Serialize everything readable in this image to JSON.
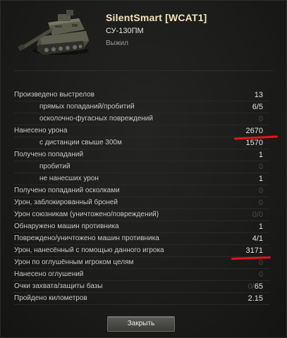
{
  "header": {
    "player_name": "SilentSmart [WCAT1]",
    "vehicle_name": "СУ-130ПМ",
    "status": "Выжил"
  },
  "stats": [
    {
      "label": "Произведено выстрелов",
      "value": "13",
      "indent": 0,
      "dim": false
    },
    {
      "label": "прямых попаданий/пробитий",
      "value": "6/5",
      "indent": 1,
      "dim": false
    },
    {
      "label": "осколочно-фугасных повреждений",
      "value": "0",
      "indent": 1,
      "dim": true
    },
    {
      "label": "Нанесено урона",
      "value": "2670",
      "indent": 0,
      "dim": false,
      "underlined": true
    },
    {
      "label": "с дистанции свыше 300м",
      "value": "1570",
      "indent": 1,
      "dim": false
    },
    {
      "label": "Получено попаданий",
      "value": "1",
      "indent": 0,
      "dim": false
    },
    {
      "label": "пробитий",
      "value": "0",
      "indent": 1,
      "dim": true
    },
    {
      "label": "не нанесших урон",
      "value": "1",
      "indent": 1,
      "dim": false
    },
    {
      "label": "Получено попаданий осколками",
      "value": "0",
      "indent": 0,
      "dim": true
    },
    {
      "label": "Урон, заблокированный броней",
      "value": "0",
      "indent": 0,
      "dim": true
    },
    {
      "label": "Урон союзникам (уничтожено/повреждений)",
      "value": "0/0",
      "indent": 0,
      "dim": true
    },
    {
      "label": "Обнаружено машин противника",
      "value": "1",
      "indent": 0,
      "dim": false
    },
    {
      "label": "Повреждено/уничтожено машин противника",
      "value": "4/1",
      "indent": 0,
      "dim": false
    },
    {
      "label": "Урон, нанесённый с помощью данного игрока",
      "value": "3171",
      "indent": 0,
      "dim": false,
      "underlined": true
    },
    {
      "label": "Урон по оглушённым игроком целям",
      "value": "0",
      "indent": 0,
      "dim": true
    },
    {
      "label": "Нанесено оглушений",
      "value": "0",
      "indent": 0,
      "dim": true
    },
    {
      "label": "Очки захвата/защиты базы",
      "value_dim_part": "0/",
      "value": "65",
      "indent": 0,
      "dim": false
    },
    {
      "label": "Пройдено километров",
      "value": "2.15",
      "indent": 0,
      "dim": false
    }
  ],
  "close_button": {
    "label": "Закрыть"
  },
  "colors": {
    "player_name": "#f2e6b8",
    "annotation_underline": "#e5141b",
    "dim_value": "#4a4a47"
  }
}
